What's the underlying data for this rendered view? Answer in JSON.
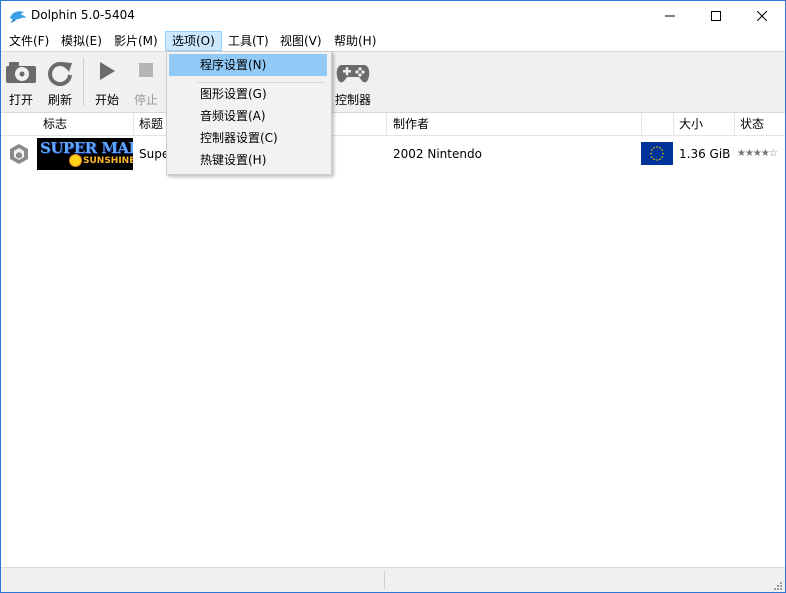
{
  "window": {
    "title": "Dolphin 5.0-5404",
    "controls": [
      "minimize-icon",
      "maximize-icon",
      "close-icon"
    ]
  },
  "menu": [
    {
      "label": "文件(F)"
    },
    {
      "label": "模拟(E)"
    },
    {
      "label": "影片(M)"
    },
    {
      "label": "选项(O)",
      "open": true
    },
    {
      "label": "工具(T)"
    },
    {
      "label": "视图(V)"
    },
    {
      "label": "帮助(H)"
    }
  ],
  "toolbar": {
    "open": "打开",
    "refresh": "刷新",
    "play": "开始",
    "stop": "停止",
    "controllers": "控制器"
  },
  "options_menu": {
    "items": [
      {
        "label": "程序设置(N)",
        "highlighted": true
      },
      {
        "label": "图形设置(G)"
      },
      {
        "label": "音频设置(A)"
      },
      {
        "label": "控制器设置(C)"
      },
      {
        "label": "热键设置(H)"
      }
    ]
  },
  "game_list": {
    "columns": {
      "banner": "标志",
      "title": "标题",
      "maker": "制作者",
      "size": "大小",
      "state": "状态"
    },
    "rows": [
      {
        "platform_icon": "gamecube-icon",
        "banner_title": "SUPER MARIO",
        "banner_subtitle": "SUNSHINE",
        "title": "Supe",
        "maker": "2002  Nintendo",
        "region_icon": "eu-flag-icon",
        "size": "1.36 GiB",
        "rating": "★★★★☆"
      }
    ]
  },
  "colors": {
    "accent": "#2b78d4",
    "menu_highlight": "#91c9f7",
    "toolbar_bg": "#f0f0f0",
    "eu_blue": "#003399"
  }
}
